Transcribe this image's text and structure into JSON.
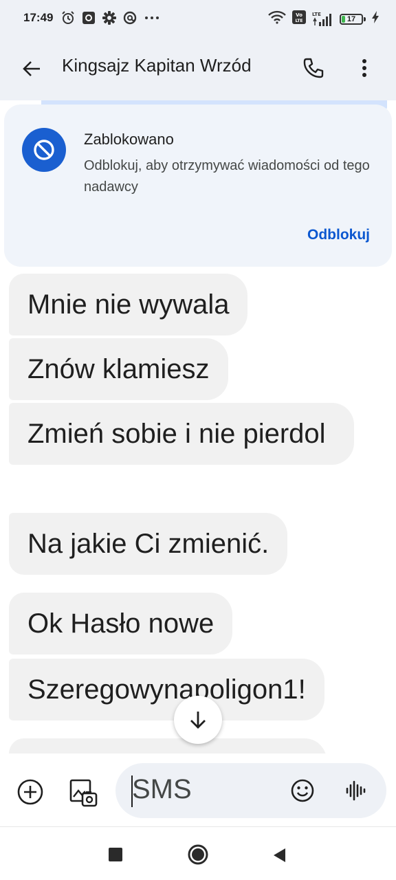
{
  "status_bar": {
    "time": "17:49",
    "battery_level": "17",
    "network_label": "LTE",
    "icons": [
      "alarm-icon",
      "screen-record-icon",
      "settings-gear-icon",
      "at-sign-icon",
      "more-notifications-icon",
      "wifi-icon",
      "volte-icon",
      "signal-icon",
      "battery-icon",
      "charging-icon"
    ]
  },
  "app_bar": {
    "contact_name": "Kingsajz Kapitan Wrzód",
    "icons": [
      "back-arrow-icon",
      "phone-icon",
      "more-vert-icon"
    ]
  },
  "blocked_card": {
    "title": "Zablokowano",
    "description": "Odblokuj, aby otrzymywać wiadomości od tego nadawcy",
    "unblock_label": "Odblokuj",
    "accent_color": "#1a5fd0"
  },
  "messages": [
    {
      "text": "Mnie nie wywala"
    },
    {
      "text": "Znów klamiesz"
    },
    {
      "text": "Zmień sobie i nie pierdol"
    },
    {
      "text": "Na jakie Ci zmienić."
    },
    {
      "text": "Ok Hasło nowe"
    },
    {
      "text": "Szeregowynapoligon1!"
    }
  ],
  "compose": {
    "placeholder": "SMS",
    "icons": [
      "add-circle-icon",
      "gallery-icon",
      "emoji-icon",
      "voice-waveform-icon"
    ]
  },
  "navigation_bar": {
    "icons": [
      "recents-square-icon",
      "home-circle-icon",
      "back-triangle-icon"
    ]
  },
  "colors": {
    "app_bar_bg": "#eef1f6",
    "bubble_bg": "#f1f1f1",
    "link_color": "#0b57d0"
  }
}
